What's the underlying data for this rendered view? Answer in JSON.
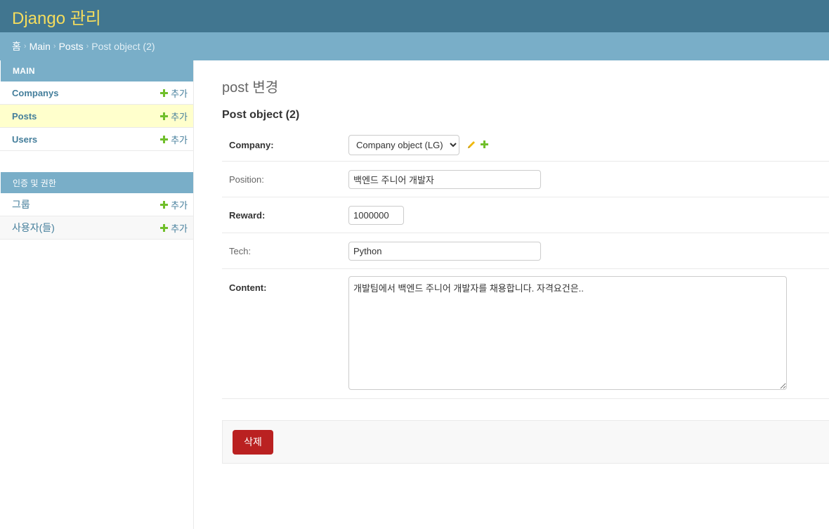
{
  "header": {
    "title": "Django 관리"
  },
  "breadcrumbs": {
    "home": "홈",
    "app": "Main",
    "model": "Posts",
    "current": "Post object (2)",
    "separator": "›"
  },
  "sidebar": {
    "main": {
      "caption": "MAIN",
      "items": [
        {
          "label": "Companys",
          "add": "추가"
        },
        {
          "label": "Posts",
          "add": "추가"
        },
        {
          "label": "Users",
          "add": "추가"
        }
      ]
    },
    "auth": {
      "caption": "인증 및 권한",
      "items": [
        {
          "label": "그룹",
          "add": "추가"
        },
        {
          "label": "사용자(들)",
          "add": "추가"
        }
      ]
    }
  },
  "content": {
    "page_title": "post 변경",
    "object_title": "Post object (2)",
    "fields": {
      "company": {
        "label": "Company:",
        "value": "Company object (LG)"
      },
      "position": {
        "label": "Position:",
        "value": "백엔드 주니어 개발자"
      },
      "reward": {
        "label": "Reward:",
        "value": "1000000"
      },
      "tech": {
        "label": "Tech:",
        "value": "Python"
      },
      "content": {
        "label": "Content:",
        "value": "개발팀에서 백엔드 주니어 개발자를 채용합니다. 자격요건은.."
      }
    },
    "delete_label": "삭제"
  },
  "colors": {
    "header_bg": "#417690",
    "title": "#f5dd5d",
    "breadcrumbs_bg": "#79aec8",
    "link": "#447e9b",
    "add_icon": "#70bf2b",
    "delete_bg": "#ba2121",
    "selected_row": "#ffffcc"
  },
  "icons": {
    "add": "plus-icon",
    "edit": "pencil-icon"
  }
}
